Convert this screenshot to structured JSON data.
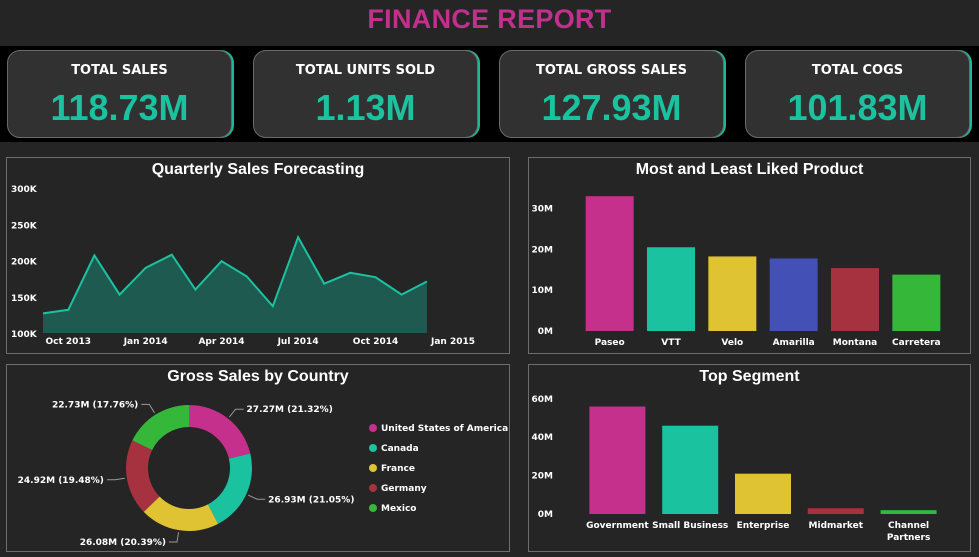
{
  "header": {
    "title": "FINANCE REPORT"
  },
  "kpis": [
    {
      "label": "TOTAL SALES",
      "value": "118.73M"
    },
    {
      "label": "TOTAL UNITS SOLD",
      "value": "1.13M"
    },
    {
      "label": "TOTAL GROSS SALES",
      "value": "127.93M"
    },
    {
      "label": "TOTAL COGS",
      "value": "101.83M"
    }
  ],
  "colors": {
    "accent": "#1bc2a0",
    "title": "#c0308c",
    "area_fill": "#1e5a4f",
    "area_line": "#1bc2a0"
  },
  "chart_data": [
    {
      "type": "area",
      "title": "Quarterly Sales Forecasting",
      "xlabel": "",
      "ylabel": "",
      "x_ticks": [
        "Oct 2013",
        "Jan 2014",
        "Apr 2014",
        "Jul 2014",
        "Oct 2014",
        "Jan 2015"
      ],
      "y_ticks": [
        "100K",
        "150K",
        "200K",
        "250K",
        "300K"
      ],
      "ylim": [
        100000,
        300000
      ],
      "x": [
        "2013-09-01",
        "2013-10-01",
        "2013-11-01",
        "2013-12-01",
        "2014-01-01",
        "2014-02-01",
        "2014-03-01",
        "2014-04-01",
        "2014-05-01",
        "2014-06-01",
        "2014-07-01",
        "2014-08-01",
        "2014-09-01",
        "2014-10-01",
        "2014-11-01",
        "2014-12-01"
      ],
      "values": [
        127000,
        132000,
        207000,
        153000,
        190000,
        208000,
        160000,
        199000,
        178000,
        137000,
        232000,
        168000,
        183000,
        177000,
        153000,
        171000
      ],
      "grid": false
    },
    {
      "type": "bar",
      "title": "Most and Least Liked Product",
      "categories": [
        "Paseo",
        "VTT",
        "Velo",
        "Amarilla",
        "Montana",
        "Carretera"
      ],
      "values": [
        33000000,
        20500000,
        18250000,
        17750000,
        15400000,
        13800000
      ],
      "colors": [
        "#c4308c",
        "#1bc2a0",
        "#e0c332",
        "#4350b6",
        "#a6323f",
        "#35b83a"
      ],
      "y_ticks": [
        "0M",
        "10M",
        "20M",
        "30M"
      ],
      "ylim": [
        0,
        35000000
      ],
      "grid": false
    },
    {
      "type": "pie",
      "title": "Gross Sales by Country",
      "categories": [
        "United States of America",
        "Canada",
        "France",
        "Germany",
        "Mexico"
      ],
      "values": [
        27.27,
        26.93,
        26.08,
        24.92,
        22.73
      ],
      "labels": [
        "27.27M (21.32%)",
        "26.93M (21.05%)",
        "26.08M (20.39%)",
        "24.92M (19.48%)",
        "22.73M (17.76%)"
      ],
      "colors": [
        "#c4308c",
        "#1bc2a0",
        "#e0c332",
        "#a6323f",
        "#35b83a"
      ],
      "legend": "right"
    },
    {
      "type": "bar",
      "title": "Top Segment",
      "categories": [
        "Government",
        "Small Business",
        "Enterprise",
        "Midmarket",
        "Channel Partners"
      ],
      "values": [
        56000000,
        46000000,
        21000000,
        3000000,
        2000000
      ],
      "colors": [
        "#c4308c",
        "#1bc2a0",
        "#e0c332",
        "#a6323f",
        "#35b83a"
      ],
      "y_ticks": [
        "0M",
        "20M",
        "40M",
        "60M"
      ],
      "ylim": [
        0,
        62000000
      ],
      "grid": false
    }
  ]
}
